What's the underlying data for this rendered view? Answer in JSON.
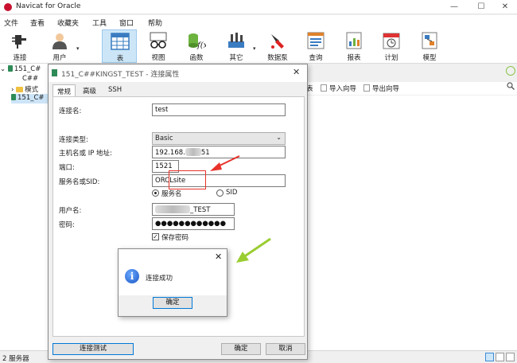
{
  "window": {
    "title": "Navicat for Oracle",
    "minimize_glyph": "—",
    "maximize_glyph": "☐",
    "close_glyph": "✕"
  },
  "menu": [
    "文件",
    "查看",
    "收藏夹",
    "工具",
    "窗口",
    "帮助"
  ],
  "toolbar": [
    {
      "label": "连接",
      "icon": "plug-icon"
    },
    {
      "label": "用户",
      "icon": "user-icon"
    },
    {
      "label": "表",
      "icon": "table-icon",
      "active": true
    },
    {
      "label": "视图",
      "icon": "glasses-icon"
    },
    {
      "label": "函数",
      "icon": "function-icon"
    },
    {
      "label": "其它",
      "icon": "tools-icon"
    },
    {
      "label": "数据泵",
      "icon": "pump-icon"
    },
    {
      "label": "查询",
      "icon": "query-icon"
    },
    {
      "label": "报表",
      "icon": "report-icon"
    },
    {
      "label": "计划",
      "icon": "calendar-icon"
    },
    {
      "label": "模型",
      "icon": "model-icon"
    }
  ],
  "navigator": {
    "rows": [
      "151_C#",
      "C##",
      "模式",
      "151_C#"
    ]
  },
  "object_bar": {
    "partial": "表",
    "import_wizard": "导入向导",
    "export_wizard": "导出向导"
  },
  "status": {
    "servers": "2 服务器"
  },
  "dialog": {
    "title": "151_C##KINGST_TEST - 连接属性",
    "close_glyph": "✕",
    "tabs": [
      "常规",
      "高级",
      "SSH"
    ],
    "fields": {
      "connection_name_label": "连接名:",
      "connection_name_value": "test",
      "connection_type_label": "连接类型:",
      "connection_type_value": "Basic",
      "host_label": "主机名或 IP 地址:",
      "host_value_prefix": "192.168.",
      "host_value_suffix": "51",
      "port_label": "端口:",
      "port_value": "1521",
      "service_label": "服务名或SID:",
      "service_value": "ORCLsite",
      "radio_service_name": "服务名",
      "radio_sid": "SID",
      "username_label": "用户名:",
      "username_suffix": "_TEST",
      "password_label": "密码:",
      "password_value": "●●●●●●●●●●●●",
      "save_password_label": "保存密码"
    },
    "buttons": {
      "test_connection": "连接测试",
      "ok": "确定",
      "cancel": "取消"
    }
  },
  "message_box": {
    "text": "连接成功",
    "ok": "确定",
    "close_glyph": "✕",
    "icon_glyph": "i"
  },
  "colors": {
    "accent": "#0078d7",
    "annotation_red": "#e8322a",
    "annotation_green": "#9acd32"
  }
}
